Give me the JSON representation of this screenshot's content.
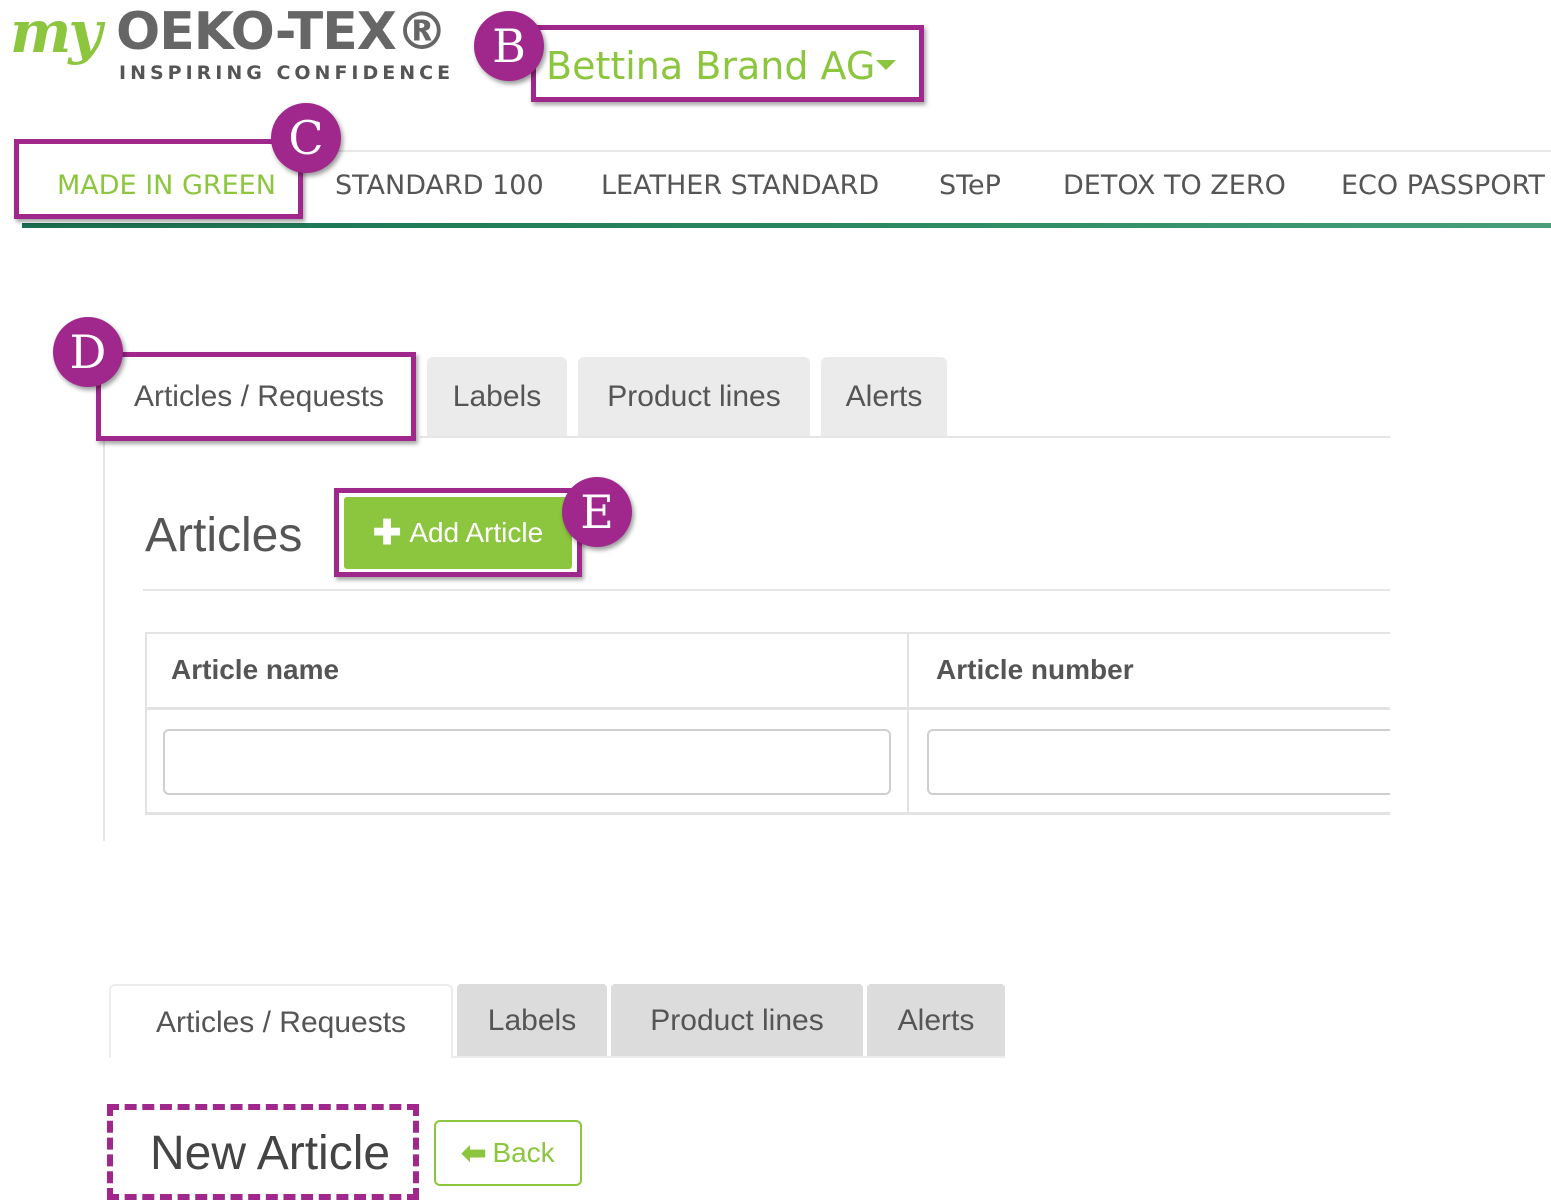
{
  "logo": {
    "prefix": "my",
    "name": "OEKO-TEX®",
    "tagline": "INSPIRING CONFIDENCE"
  },
  "brand_selector": {
    "value": "Bettina Brand AG",
    "icon": "caret-down-icon"
  },
  "main_nav": {
    "items": [
      {
        "label": "MADE IN GREEN",
        "active": true
      },
      {
        "label": "STANDARD 100"
      },
      {
        "label": "LEATHER STANDARD"
      },
      {
        "label": "STeP"
      },
      {
        "label": "DETOX TO ZERO"
      },
      {
        "label": "ECO PASSPORT"
      }
    ]
  },
  "tabs": [
    "Articles / Requests",
    "Labels",
    "Product lines",
    "Alerts"
  ],
  "articles": {
    "title": "Articles",
    "add_button": "Add Article",
    "table": {
      "columns": [
        "Article name",
        "Article number"
      ]
    }
  },
  "new_article": {
    "title": "New Article",
    "back_button": "Back"
  },
  "annotations": {
    "b": "B",
    "c": "C",
    "d": "D",
    "e": "E"
  },
  "colors": {
    "accent_green": "#8cc63e",
    "annotation_purple": "#a0288c",
    "nav_underline": "#1b6e50"
  }
}
